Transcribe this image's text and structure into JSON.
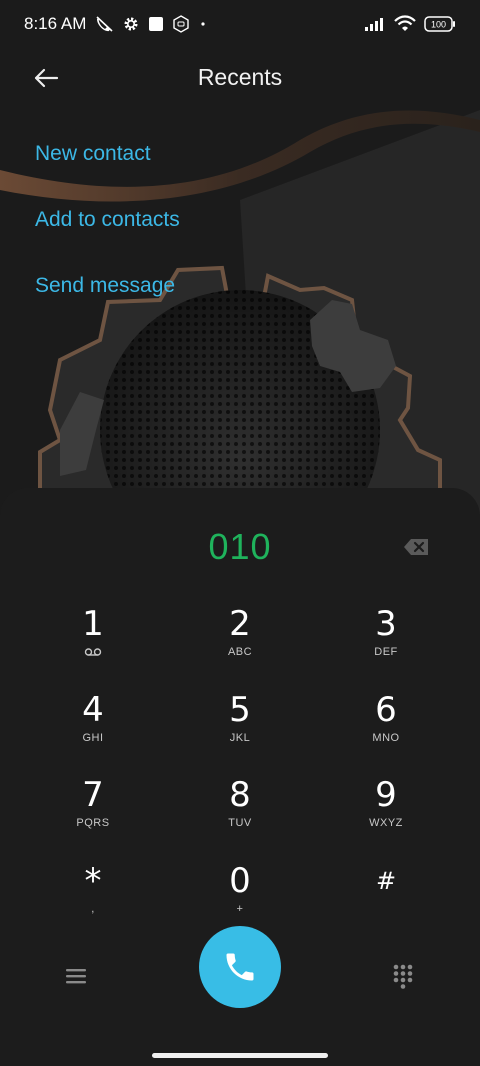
{
  "status_bar": {
    "time": "8:16 AM",
    "battery": "100",
    "icons": [
      "missed-call-icon",
      "settings-gear-icon",
      "square-icon",
      "app-notification-icon",
      "dot-icon",
      "signal-icon",
      "wifi-icon",
      "battery-icon"
    ]
  },
  "header": {
    "title": "Recents",
    "back_icon": "arrow-left-icon"
  },
  "actions": [
    {
      "label": "New contact"
    },
    {
      "label": "Add to contacts"
    },
    {
      "label": "Send message"
    }
  ],
  "dialer": {
    "number": "010",
    "number_color": "#1fb35c",
    "backspace_icon": "backspace-icon"
  },
  "keys": [
    {
      "digit": "1",
      "letters": ""
    },
    {
      "digit": "2",
      "letters": "ABC"
    },
    {
      "digit": "3",
      "letters": "DEF"
    },
    {
      "digit": "4",
      "letters": "GHI"
    },
    {
      "digit": "5",
      "letters": "JKL"
    },
    {
      "digit": "6",
      "letters": "MNO"
    },
    {
      "digit": "7",
      "letters": "PQRS"
    },
    {
      "digit": "8",
      "letters": "TUV"
    },
    {
      "digit": "9",
      "letters": "WXYZ"
    },
    {
      "digit": "*",
      "letters": ","
    },
    {
      "digit": "0",
      "letters": "+"
    },
    {
      "digit": "#",
      "letters": ""
    }
  ],
  "bottom_bar": {
    "menu_icon": "hamburger-menu-icon",
    "call_icon": "phone-icon",
    "dialpad_icon": "dialpad-grid-icon"
  },
  "colors": {
    "accent": "#3cb8e6",
    "call_button": "#38bde6",
    "background": "#1a1a1a"
  }
}
